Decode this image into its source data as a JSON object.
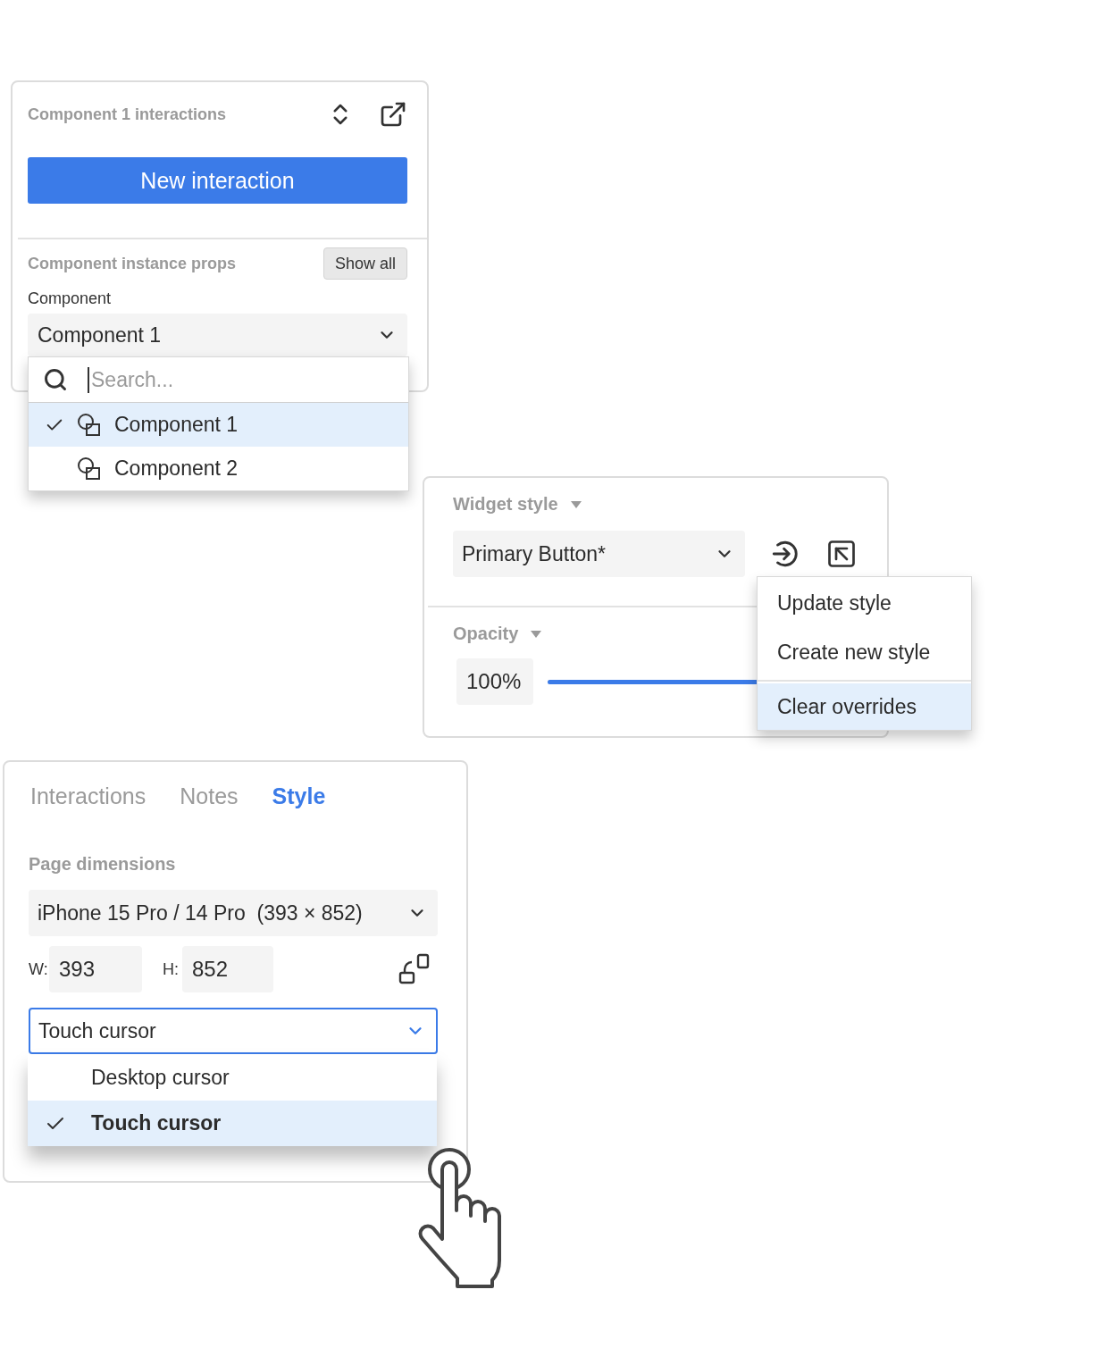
{
  "interactions_panel": {
    "title": "Component 1 interactions",
    "new_button": "New interaction",
    "props_heading": "Component instance props",
    "show_all": "Show all",
    "field_label": "Component",
    "select_value": "Component 1",
    "dropdown": {
      "placeholder": "Search...",
      "options": [
        {
          "label": "Component 1",
          "selected": true
        },
        {
          "label": "Component 2",
          "selected": false
        }
      ]
    }
  },
  "style_panel": {
    "widget_style_label": "Widget style",
    "style_value": "Primary Button*",
    "opacity_label": "Opacity",
    "opacity_value": "100%",
    "opacity_slider": {
      "level": 1
    },
    "menu": [
      {
        "label": "Update style",
        "selected": false,
        "divider_before": false
      },
      {
        "label": "Create new style",
        "selected": false,
        "divider_before": false
      },
      {
        "label": "Clear overrides",
        "selected": true,
        "divider_before": true
      }
    ]
  },
  "page_panel": {
    "tabs": [
      {
        "label": "Interactions",
        "selected": false
      },
      {
        "label": "Notes",
        "selected": false
      },
      {
        "label": "Style",
        "selected": true
      }
    ],
    "section_label": "Page dimensions",
    "device_value": "iPhone 15 Pro / 14 Pro  (393 × 852)",
    "width_label": "W:",
    "width_value": "393",
    "height_label": "H:",
    "height_value": "852",
    "cursor_value": "Touch cursor",
    "cursor_options": [
      {
        "label": "Desktop cursor",
        "selected": false
      },
      {
        "label": "Touch cursor",
        "selected": true
      }
    ]
  }
}
